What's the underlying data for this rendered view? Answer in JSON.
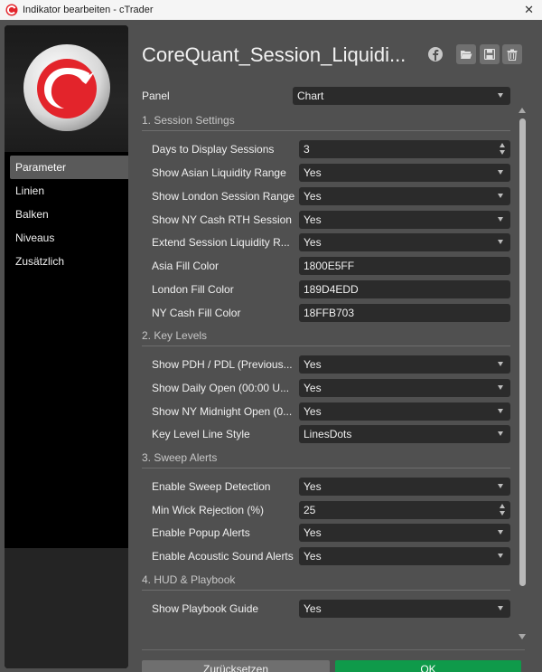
{
  "window": {
    "title": "Indikator bearbeiten - cTrader",
    "close_glyph": "✕"
  },
  "sidebar": {
    "items": [
      {
        "label": "Parameter",
        "active": true
      },
      {
        "label": "Linien"
      },
      {
        "label": "Balken"
      },
      {
        "label": "Niveaus"
      },
      {
        "label": "Zusätzlich"
      }
    ]
  },
  "header": {
    "title": "CoreQuant_Session_Liquidi..."
  },
  "panel": {
    "label": "Panel",
    "value": "Chart"
  },
  "sections": {
    "s1": "1. Session Settings",
    "s2": "2. Key Levels",
    "s3": "3. Sweep Alerts",
    "s4": "4. HUD & Playbook"
  },
  "params": {
    "days": {
      "label": "Days to Display Sessions",
      "value": "3"
    },
    "asian": {
      "label": "Show Asian Liquidity Range",
      "value": "Yes"
    },
    "london": {
      "label": "Show London Session Range",
      "value": "Yes"
    },
    "ny_rth": {
      "label": "Show NY Cash RTH Session",
      "value": "Yes"
    },
    "extend": {
      "label": "Extend Session Liquidity R...",
      "value": "Yes"
    },
    "asia_color": {
      "label": "Asia Fill Color",
      "value": "1800E5FF"
    },
    "london_color": {
      "label": "London Fill Color",
      "value": "189D4EDD"
    },
    "ny_color": {
      "label": "NY Cash Fill Color",
      "value": "18FFB703"
    },
    "pdh": {
      "label": "Show PDH / PDL (Previous...",
      "value": "Yes"
    },
    "daily_open": {
      "label": "Show Daily Open (00:00 U...",
      "value": "Yes"
    },
    "ny_midnight": {
      "label": "Show NY Midnight Open (0...",
      "value": "Yes"
    },
    "line_style": {
      "label": "Key Level Line Style",
      "value": "LinesDots"
    },
    "sweep": {
      "label": "Enable Sweep Detection",
      "value": "Yes"
    },
    "wick": {
      "label": "Min Wick Rejection (%)",
      "value": "25"
    },
    "popup": {
      "label": "Enable Popup Alerts",
      "value": "Yes"
    },
    "acoustic": {
      "label": "Enable Acoustic Sound Alerts",
      "value": "Yes"
    },
    "playbook": {
      "label": "Show Playbook Guide",
      "value": "Yes"
    }
  },
  "footer": {
    "reset_label": "Zurücksetzen",
    "ok_label": "OK"
  },
  "colors": {
    "accent_green": "#0f9a4a",
    "brand_red": "#e3242b",
    "dialog_bg": "#505050"
  }
}
